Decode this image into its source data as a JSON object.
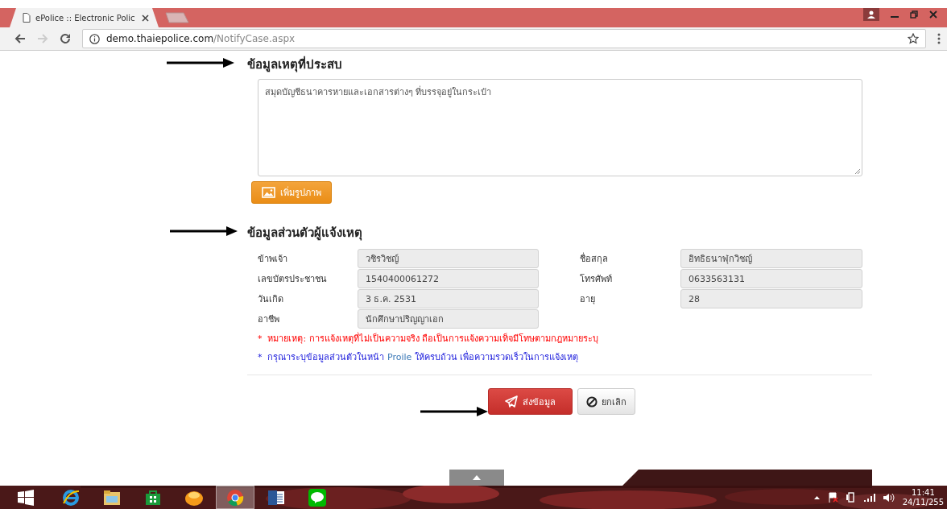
{
  "browser": {
    "tab_title": "ePolice :: Electronic Polic",
    "url_host": "demo.thaiepolice.com",
    "url_path": "/NotifyCase.aspx"
  },
  "incident": {
    "heading": "ข้อมูลเหตุที่ประสบ",
    "description": "สมุดบัญชีธนาคารหายและเอกสารต่างๆ ที่บรรจุอยู่ในกระเป๋า",
    "add_photo_button": "เพิ่มรูปภาพ"
  },
  "reporter": {
    "heading": "ข้อมูลส่วนตัวผู้แจ้งเหตุ",
    "fields": [
      {
        "label": "ข้าพเจ้า",
        "value": "วชิรวิชญ์"
      },
      {
        "label": "ชื่อสกุล",
        "value": "อิทธิธนาฬุกวิชญ์"
      },
      {
        "label": "เลขบัตรประชาชน",
        "value": "1540400061272"
      },
      {
        "label": "โทรศัพท์",
        "value": "0633563131"
      },
      {
        "label": "วันเกิด",
        "value": "3 ธ.ค. 2531"
      },
      {
        "label": "อายุ",
        "value": "28"
      },
      {
        "label": "อาชีพ",
        "value": "นักศึกษาปริญญาเอก"
      }
    ]
  },
  "notes": [
    {
      "kind": "warning",
      "marker": "*",
      "text": "หมายเหตุ: การแจ้งเหตุที่ไม่เป็นความจริง ถือเป็นการแจ้งความเท็จมีโทษตามกฎหมายระบุ"
    },
    {
      "kind": "info",
      "marker": "*",
      "text": "กรุณาระบุข้อมูลส่วนตัวในหน้า",
      "link": "Proile",
      "after": "ให้ครบถ้วน เพื่อความรวดเร็วในการแจ้งเหตุ"
    }
  ],
  "actions": [
    {
      "kind": "primary",
      "label": "ส่งข้อมูล"
    },
    {
      "kind": "secondary",
      "label": "ยกเลิก"
    }
  ],
  "taskbar": {
    "apps": [
      {
        "kind": "ie",
        "selected": false
      },
      {
        "kind": "explorer",
        "selected": false
      },
      {
        "kind": "store",
        "selected": false
      },
      {
        "kind": "orange",
        "selected": false
      },
      {
        "kind": "chrome",
        "selected": true
      },
      {
        "kind": "word",
        "selected": false
      },
      {
        "kind": "line",
        "selected": false
      }
    ],
    "time": "11:41",
    "date": "24/11/255"
  }
}
